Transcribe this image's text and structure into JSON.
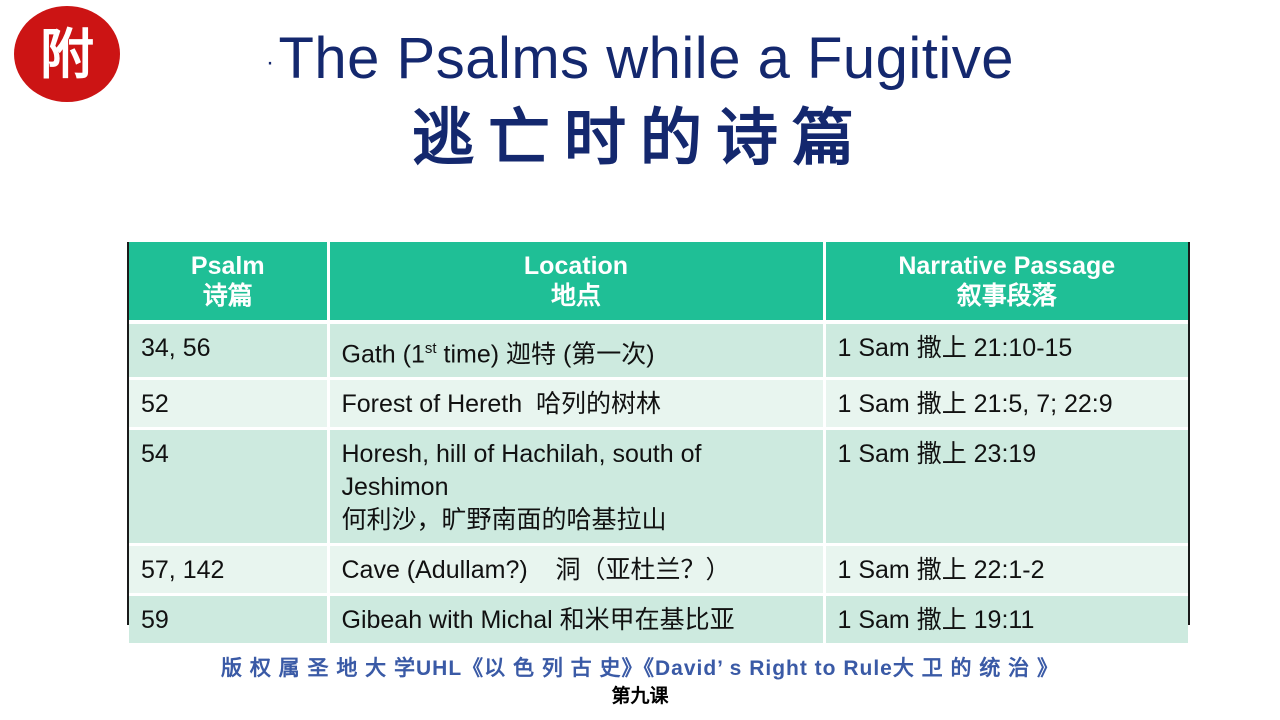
{
  "badge": {
    "text": "附",
    "color": "#cc1414"
  },
  "title": {
    "bullet": "·",
    "english": "The Psalms while a Fugitive",
    "chinese": "逃亡时的诗篇",
    "color": "#14286e"
  },
  "table": {
    "header_color": "#1fbf96",
    "columns": [
      {
        "en": "Psalm",
        "zh": "诗篇"
      },
      {
        "en": "Location",
        "zh": "地点"
      },
      {
        "en": "Narrative Passage",
        "zh": "叙事段落"
      }
    ],
    "rows": [
      {
        "psalm": "34, 56",
        "location_pre": "Gath (1",
        "location_sup": "st",
        "location_post": " time) 迦特 (第一次)",
        "passage": "1 Sam 撒上 21:10-15"
      },
      {
        "psalm": "52",
        "location_line1": "Forest of Hereth  哈列的树林",
        "passage": "1 Sam 撒上 21:5, 7; 22:9"
      },
      {
        "psalm": "54",
        "location_line1": "Horesh, hill of Hachilah, south of",
        "location_line2": "Jeshimon",
        "location_line3": "何利沙，旷野南面的哈基拉山",
        "passage": "1 Sam 撒上 23:19"
      },
      {
        "psalm": "57, 142",
        "location_line1": "Cave (Adullam?)    洞（亚杜兰？）",
        "passage": "1 Sam 撒上 22:1-2"
      },
      {
        "psalm": "59",
        "location_line1": "Gibeah with Michal 和米甲在基比亚",
        "passage": "1 Sam 撒上 19:11"
      }
    ]
  },
  "footer": {
    "line1": "版 权 属 圣 地 大 学UHL《以 色 列 古 史》《David’ s Right to Rule大 卫 的 统 治 》",
    "line2": "第九课"
  }
}
